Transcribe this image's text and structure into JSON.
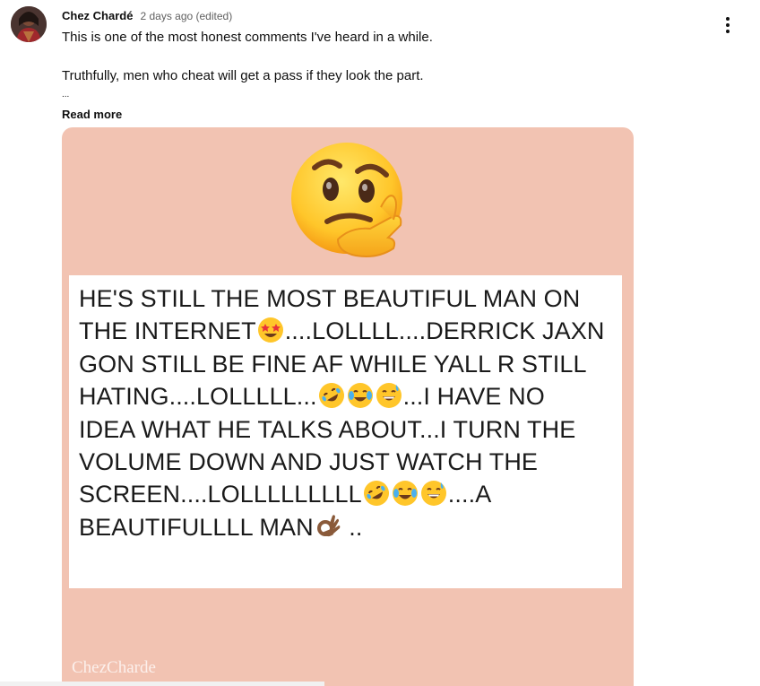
{
  "comment": {
    "author": "Chez Chardé",
    "timestamp": "2 days ago (edited)",
    "text_line_1": "This is one of the most honest comments I've heard in a while.",
    "text_line_2": "Truthfully, men who cheat will get a pass if they look the part.",
    "truncation": "...",
    "read_more_label": "Read more",
    "menu_icon": "vertical-dots-icon",
    "avatar_icon": "user-avatar-photo"
  },
  "attached_image": {
    "background_color": "#f2c3b2",
    "top_emoji": "thinking-face-emoji",
    "quote_lines": {
      "l1": "HE'S STILL THE MOST BEAUTIFUL MAN ON",
      "l2a": "THE INTERNET",
      "l2b": "....LOLLLL....DERRICK JAXN",
      "l3": "GON STILL BE FINE AF WHILE YALL R STILL",
      "l4a": "HATING....LOLLLLL...",
      "l4b": "...I HAVE NO",
      "l5": "IDEA WHAT HE TALKS ABOUT...I TURN THE",
      "l6": "VOLUME DOWN AND JUST WATCH THE",
      "l7a": "SCREEN....LOLLLLLLLLL",
      "l7b": "....A",
      "l8a": "BEAUTIFULLLL MAN",
      "l8b": " .."
    },
    "watermark": "ChezCharde"
  }
}
